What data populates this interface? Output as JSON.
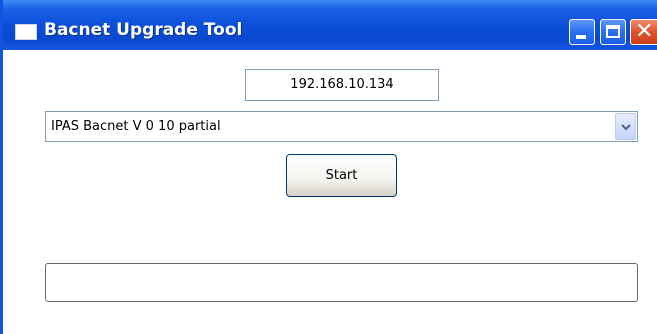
{
  "window": {
    "title": "Bacnet Upgrade Tool"
  },
  "ip_field": {
    "value": "192.168.10.134"
  },
  "firmware_dropdown": {
    "selected": "IPAS Bacnet V 0 10 partial"
  },
  "start_button": {
    "label": "Start"
  },
  "progress": {
    "fraction": 0
  },
  "colors": {
    "titlebar": "#0c4fd9",
    "close_button": "#e0512c",
    "field_border": "#7f9db9"
  }
}
